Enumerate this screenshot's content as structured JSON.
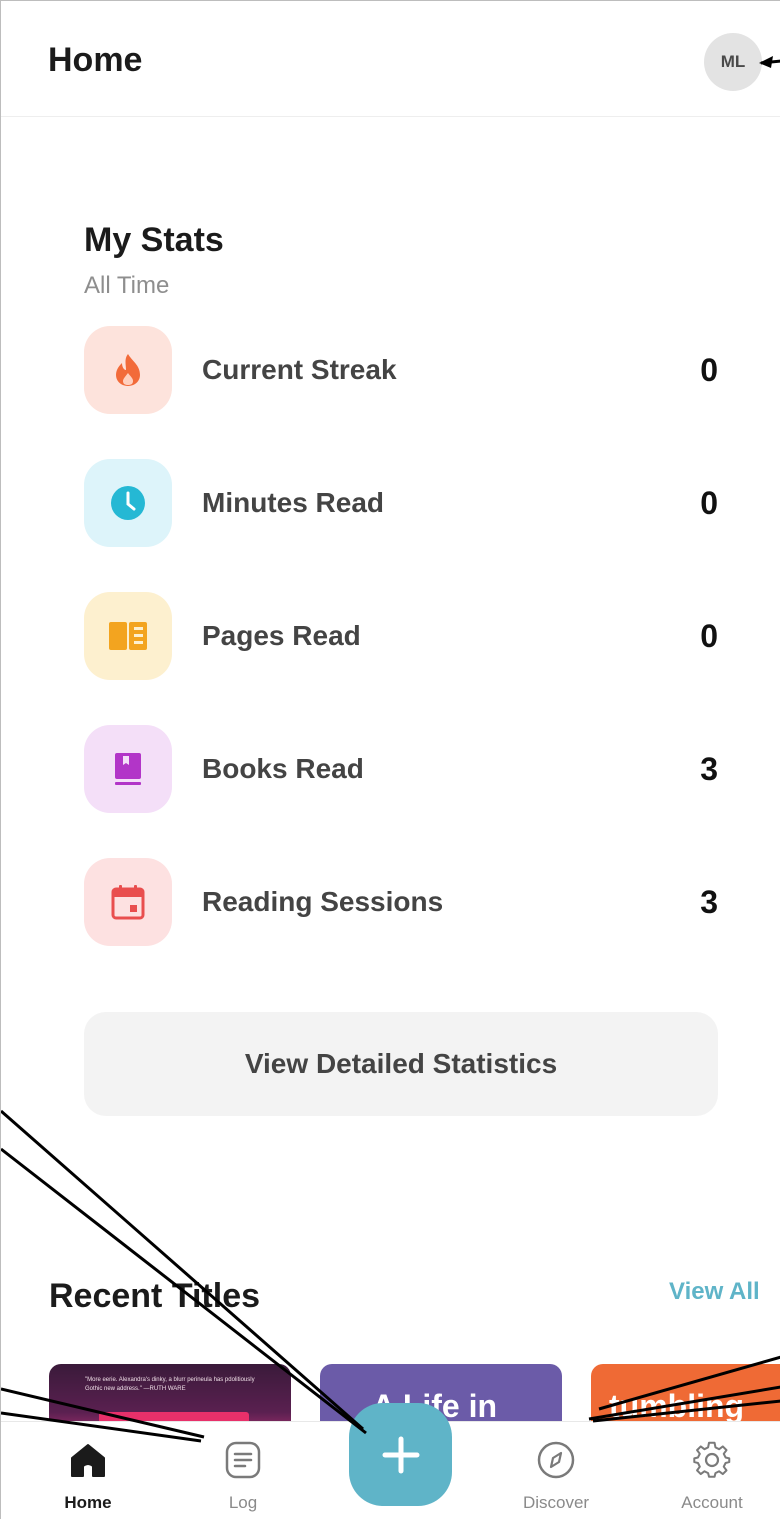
{
  "header": {
    "title": "Home",
    "avatar_initials": "ML"
  },
  "stats": {
    "title": "My Stats",
    "subtitle": "All Time",
    "items": [
      {
        "label": "Current Streak",
        "value": "0",
        "icon": "flame-icon",
        "icon_color": "#f26b3a",
        "bg_color": "#fde3dc"
      },
      {
        "label": "Minutes Read",
        "value": "0",
        "icon": "clock-icon",
        "icon_color": "#25b8d4",
        "bg_color": "#ddf4fa"
      },
      {
        "label": "Pages Read",
        "value": "0",
        "icon": "book-open-icon",
        "icon_color": "#f3a41f",
        "bg_color": "#fdf0cf"
      },
      {
        "label": "Books Read",
        "value": "3",
        "icon": "book-icon",
        "icon_color": "#b235c8",
        "bg_color": "#f4dff8"
      },
      {
        "label": "Reading Sessions",
        "value": "3",
        "icon": "calendar-icon",
        "icon_color": "#e94e4e",
        "bg_color": "#fde1e1"
      }
    ],
    "detail_button_label": "View Detailed Statistics"
  },
  "recent": {
    "title": "Recent Titles",
    "view_all_label": "View All",
    "books": [
      {
        "cover_quote": "\"More eerie. Alexandra's dinky, a blurr perineula has pdolitiously Gothic new address.\" —RUTH WARE",
        "cover_color": "#5a2050"
      },
      {
        "cover_text": "A Life in",
        "cover_color": "#6b5ba8"
      },
      {
        "cover_text": "tumbling",
        "cover_color": "#ef6a35"
      }
    ]
  },
  "nav": {
    "items": [
      {
        "label": "Home",
        "icon": "home-icon",
        "active": true
      },
      {
        "label": "Log",
        "icon": "log-icon",
        "active": false
      },
      {
        "label": "Discover",
        "icon": "compass-icon",
        "active": false
      },
      {
        "label": "Account",
        "icon": "gear-icon",
        "active": false
      }
    ],
    "fab_icon": "plus-icon"
  },
  "colors": {
    "accent": "#5fb4c8"
  }
}
